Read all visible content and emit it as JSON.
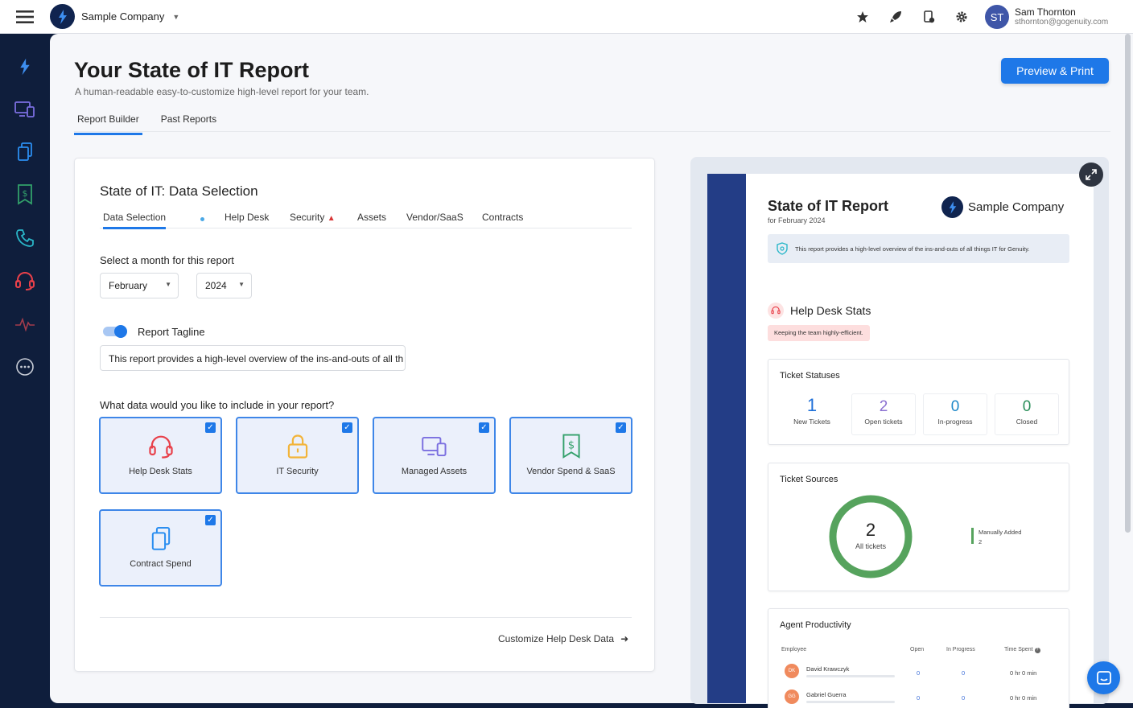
{
  "topbar": {
    "company_name": "Sample Company",
    "user_initials": "ST",
    "user_name": "Sam Thornton",
    "user_email": "sthornton@gogenuity.com"
  },
  "header": {
    "title": "Your State of IT Report",
    "subtitle": "A human-readable easy-to-customize high-level report for your team.",
    "preview_button": "Preview & Print",
    "tabs": [
      {
        "label": "Report Builder",
        "active": true
      },
      {
        "label": "Past Reports",
        "active": false
      }
    ]
  },
  "builder": {
    "title": "State of IT: Data Selection",
    "subtabs": [
      "Data Selection",
      "Help Desk",
      "Security",
      "Assets",
      "Vendor/SaaS",
      "Contracts"
    ],
    "month_label": "Select a month for this report",
    "month_value": "February",
    "year_value": "2024",
    "tagline_label": "Report Tagline",
    "tagline_enabled": true,
    "tagline_value": "This report provides a high-level overview of the ins-and-outs of all th",
    "include_label": "What data would you like to include in your report?",
    "tiles": [
      {
        "label": "Help Desk Stats",
        "icon": "headset-icon",
        "checked": true
      },
      {
        "label": "IT Security",
        "icon": "lock-icon",
        "checked": true
      },
      {
        "label": "Managed Assets",
        "icon": "devices-icon",
        "checked": true
      },
      {
        "label": "Vendor Spend & SaaS",
        "icon": "receipt-icon",
        "checked": true
      },
      {
        "label": "Contract Spend",
        "icon": "documents-icon",
        "checked": true
      }
    ],
    "customize_link": "Customize Help Desk Data"
  },
  "preview": {
    "title": "State of IT Report",
    "subtitle": "for February 2024",
    "company": "Sample Company",
    "tagline": "This report provides a high-level overview of the ins-and-outs of all things IT for Genuity.",
    "helpdesk_title": "Help Desk Stats",
    "helpdesk_pill": "Keeping the team highly-efficient.",
    "ticket_statuses": {
      "title": "Ticket Statuses",
      "items": [
        {
          "value": "1",
          "label": "New Tickets",
          "color": "#1e6fd8"
        },
        {
          "value": "2",
          "label": "Open tickets",
          "color": "#8a6fd0"
        },
        {
          "value": "0",
          "label": "In-progress",
          "color": "#1e88c8"
        },
        {
          "value": "0",
          "label": "Closed",
          "color": "#2a8f5a"
        }
      ]
    },
    "ticket_sources": {
      "title": "Ticket Sources",
      "total": "2",
      "total_label": "All tickets",
      "legend_label": "Manually Added",
      "legend_value": "2",
      "color": "#56a35d"
    },
    "agent_productivity": {
      "title": "Agent Productivity",
      "headers": [
        "Employee",
        "Open",
        "In Progress",
        "Time Spent"
      ],
      "rows": [
        {
          "initials": "DK",
          "name": "David Krawczyk",
          "open": "0",
          "in_progress": "0",
          "time": "0 hr 0 min"
        },
        {
          "initials": "GG",
          "name": "Gabriel Guerra",
          "open": "0",
          "in_progress": "0",
          "time": "0 hr 0 min"
        }
      ]
    }
  }
}
